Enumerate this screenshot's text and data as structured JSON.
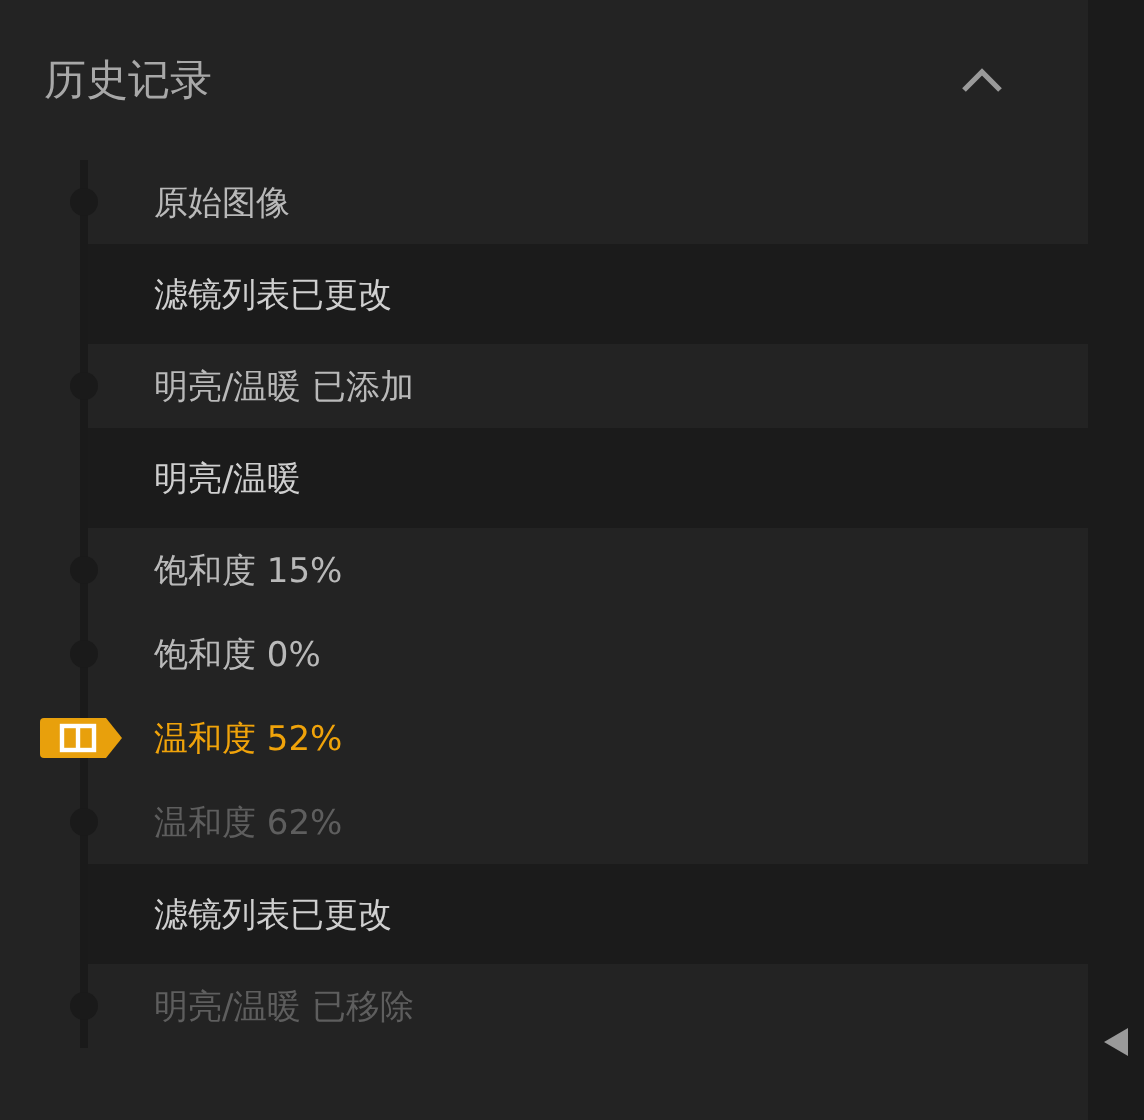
{
  "panel": {
    "title": "历史记录",
    "expanded": true
  },
  "items": [
    {
      "kind": "step",
      "label": "原始图像",
      "selected": false,
      "disabled": false
    },
    {
      "kind": "group",
      "label": "滤镜列表已更改",
      "selected": false,
      "disabled": false
    },
    {
      "kind": "step",
      "label": "明亮/温暖 已添加",
      "selected": false,
      "disabled": false
    },
    {
      "kind": "group",
      "label": "明亮/温暖",
      "selected": false,
      "disabled": false
    },
    {
      "kind": "step",
      "label": "饱和度 15%",
      "selected": false,
      "disabled": false
    },
    {
      "kind": "step",
      "label": "饱和度 0%",
      "selected": false,
      "disabled": false
    },
    {
      "kind": "step",
      "label": "温和度 52%",
      "selected": true,
      "disabled": false
    },
    {
      "kind": "step",
      "label": "温和度 62%",
      "selected": false,
      "disabled": true
    },
    {
      "kind": "group",
      "label": "滤镜列表已更改",
      "selected": false,
      "disabled": false
    },
    {
      "kind": "step",
      "label": "明亮/温暖 已移除",
      "selected": false,
      "disabled": true
    }
  ]
}
